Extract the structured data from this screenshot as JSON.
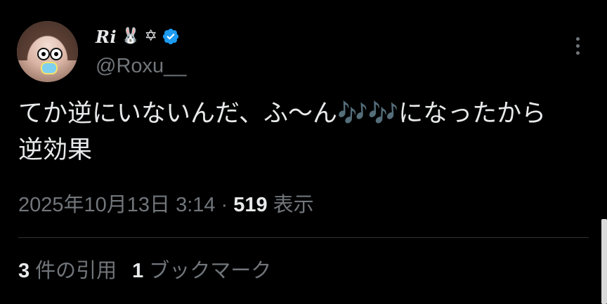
{
  "author": {
    "display_name": "Ri",
    "name_emoji_1": "🐰",
    "name_emoji_2": "✡",
    "handle": "@Roxu__",
    "verified": true,
    "verified_color": "#1d9bf0"
  },
  "tweet": {
    "text": "てか逆にいないんだ、ふ〜ん🎶🎶になったから\n逆効果",
    "date": "2025年10月13日 3:14",
    "separator": "·",
    "views_count": "519",
    "views_label": "表示"
  },
  "stats": {
    "quotes_count": "3",
    "quotes_label": "件の引用",
    "bookmarks_count": "1",
    "bookmarks_label": "ブックマーク"
  },
  "icons": {
    "more": "more-vertical-icon",
    "verified": "verified-badge-icon"
  },
  "colors": {
    "background": "#000000",
    "text_primary": "#e7e9ea",
    "text_secondary": "#71767b",
    "divider": "#2f3336"
  }
}
